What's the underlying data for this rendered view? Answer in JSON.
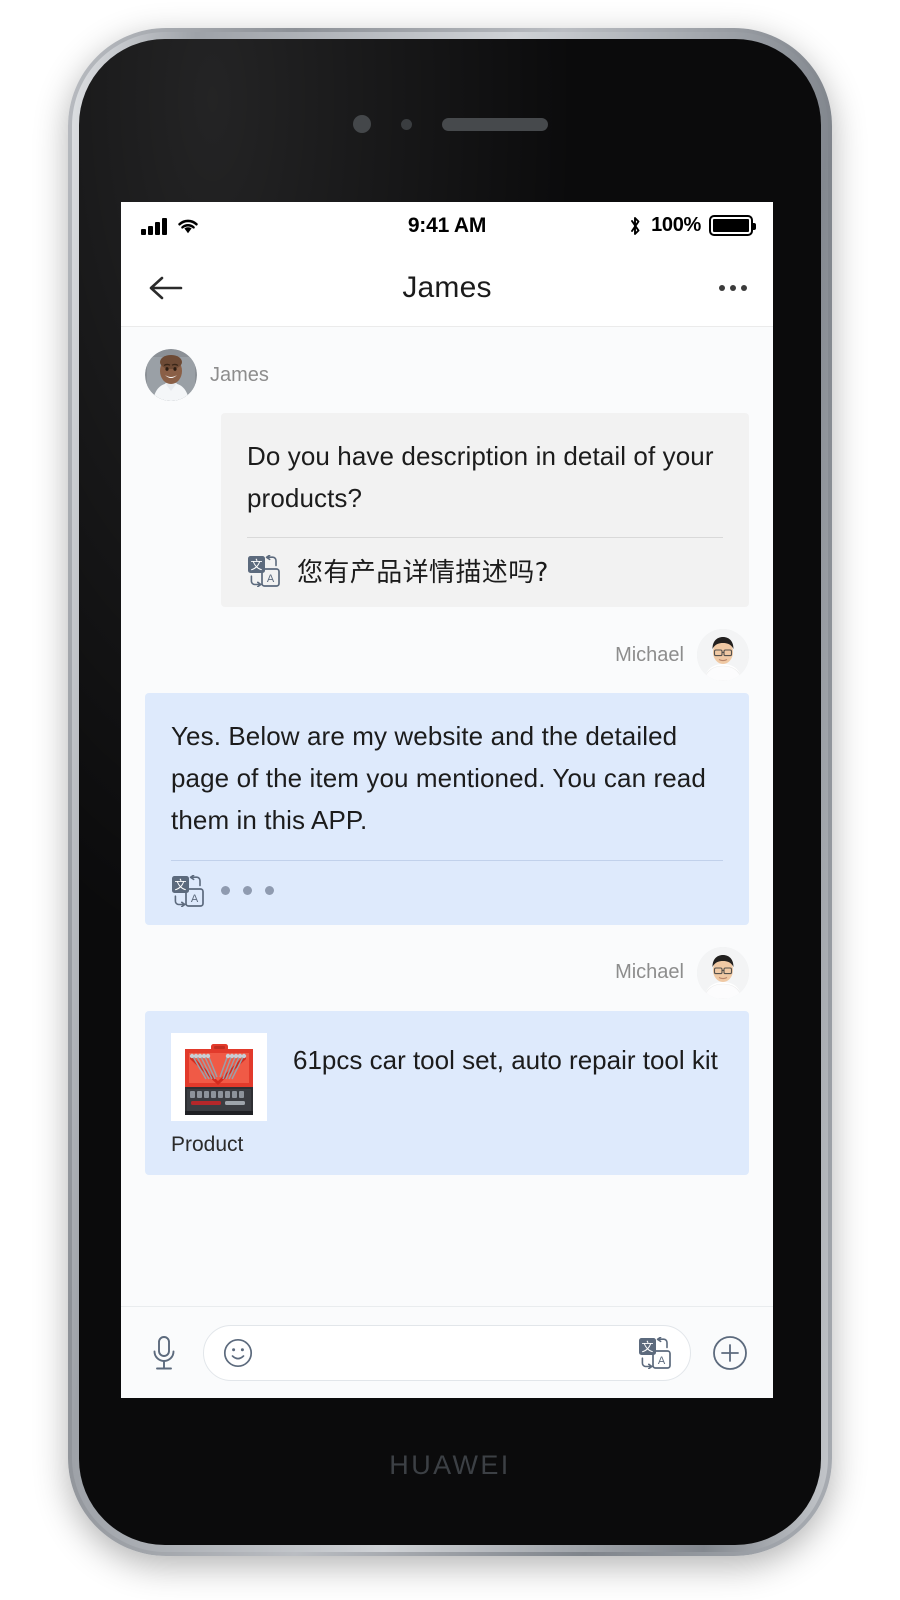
{
  "device": {
    "brand_label": "HUAWEI",
    "hardware": {
      "camera": "front-camera",
      "sensor": "proximity-sensor",
      "speaker": "earpiece-speaker"
    }
  },
  "status_bar": {
    "signal_icon": "cellular-signal-icon",
    "wifi_icon": "wifi-icon",
    "time": "9:41 AM",
    "bluetooth_icon": "bluetooth-icon",
    "battery_percent": "100%",
    "battery_icon": "battery-full-icon"
  },
  "nav_bar": {
    "back_icon": "arrow-left-icon",
    "title": "James",
    "more_icon": "more-horizontal-icon"
  },
  "colors": {
    "incoming_bubble": "#f2f2f2",
    "outgoing_bubble": "#deeafc",
    "chat_background": "#fafbfc",
    "name_text": "#8d8d8d",
    "message_text": "#1c1c1c",
    "dot_color": "#8f9bb0"
  },
  "messages": [
    {
      "id": "msg-1",
      "sender": "James",
      "side": "incoming",
      "avatar": "james-avatar",
      "text": "Do you have description in detail of  your products?",
      "translate_icon": "translate-icon",
      "translation": "您有产品详情描述吗?"
    },
    {
      "id": "msg-2",
      "sender": "Michael",
      "side": "outgoing",
      "avatar": "michael-avatar",
      "text": "Yes. Below are my website and the detailed page of the item you mentioned. You can read them in this APP.",
      "translate_icon": "translate-icon",
      "translation_status": "loading-dots"
    },
    {
      "id": "msg-3",
      "sender": "Michael",
      "side": "outgoing",
      "avatar": "michael-avatar",
      "card": {
        "thumbnail": "product-tool-kit-thumbnail",
        "caption": "Product",
        "title": "61pcs car tool set, auto repair tool kit"
      }
    }
  ],
  "input_bar": {
    "mic_icon": "microphone-icon",
    "emoji_icon": "smiley-icon",
    "input_value": "",
    "input_placeholder": "",
    "translate_icon": "translate-icon",
    "add_icon": "plus-circle-icon"
  }
}
